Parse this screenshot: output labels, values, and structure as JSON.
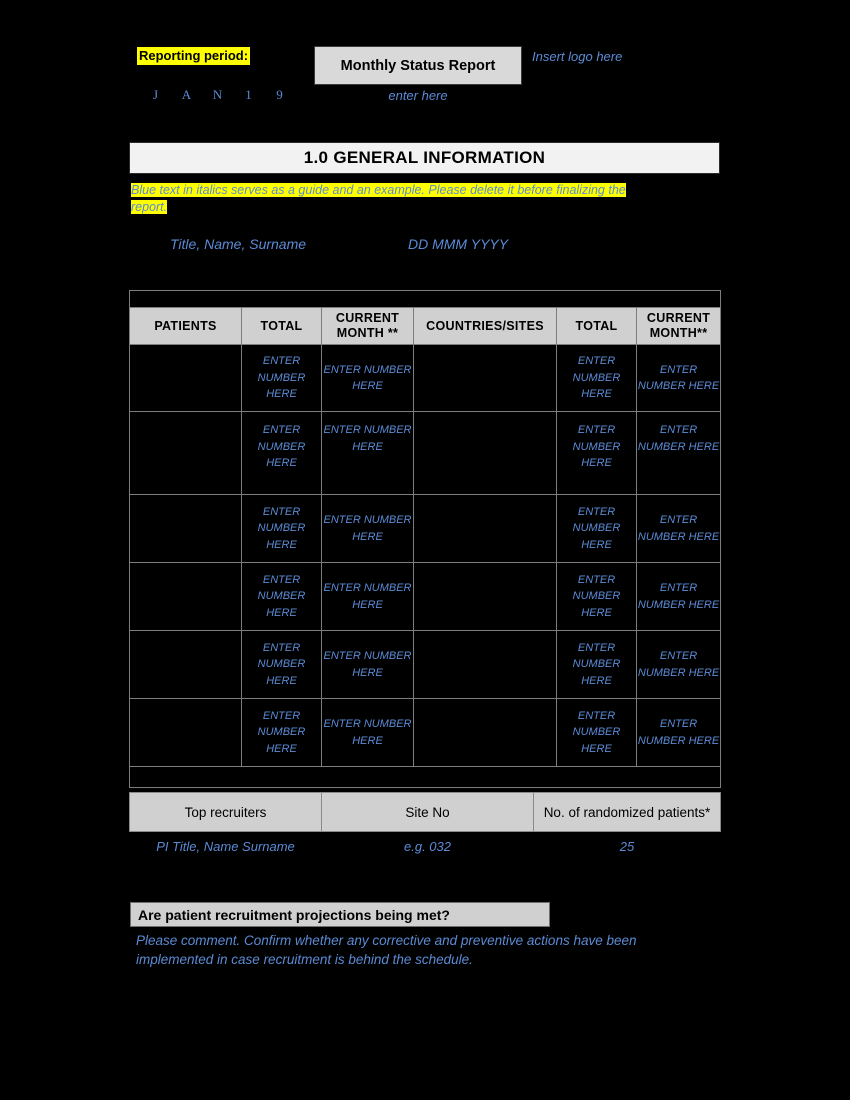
{
  "header": {
    "reporting_period_label": "Reporting period:",
    "period_chars": [
      "J",
      "A",
      "N",
      "1",
      "9"
    ],
    "document_title": "Monthly Status Report",
    "title_hint": "enter here",
    "logo_placeholder": "Insert logo here"
  },
  "section": {
    "banner_title": "1.0 GENERAL INFORMATION",
    "guide_note": "Blue text in italics serves as a guide and an example. Please delete it before finalizing the report.",
    "author_placeholder": "Title, Name, Surname",
    "date_placeholder": "DD MMM YYYY"
  },
  "main_table": {
    "headers": [
      "PATIENTS",
      "TOTAL",
      "CURRENT MONTH **",
      "COUNTRIES/SITES",
      "TOTAL",
      "CURRENT MONTH**"
    ],
    "number_placeholder": "ENTER NUMBER HERE",
    "rows": [
      {
        "patients": "",
        "total": "ENTER NUMBER HERE",
        "current_month": "ENTER NUMBER HERE",
        "countries_sites": "",
        "total2": "ENTER NUMBER HERE",
        "current_month2": "ENTER NUMBER HERE"
      },
      {
        "patients": "",
        "total": "ENTER NUMBER HERE",
        "current_month": "ENTER NUMBER HERE",
        "countries_sites": "",
        "total2": "ENTER NUMBER HERE",
        "current_month2": "ENTER NUMBER HERE"
      },
      {
        "patients": "",
        "total": "ENTER NUMBER HERE",
        "current_month": "ENTER NUMBER HERE",
        "countries_sites": "",
        "total2": "ENTER NUMBER HERE",
        "current_month2": "ENTER NUMBER HERE"
      },
      {
        "patients": "",
        "total": "ENTER NUMBER HERE",
        "current_month": "ENTER NUMBER HERE",
        "countries_sites": "",
        "total2": "ENTER NUMBER HERE",
        "current_month2": "ENTER NUMBER HERE"
      },
      {
        "patients": "",
        "total": "ENTER NUMBER HERE",
        "current_month": "ENTER NUMBER HERE",
        "countries_sites": "",
        "total2": "ENTER NUMBER HERE",
        "current_month2": "ENTER NUMBER HERE"
      },
      {
        "patients": "",
        "total": "ENTER NUMBER HERE",
        "current_month": "ENTER NUMBER HERE",
        "countries_sites": "",
        "total2": "ENTER NUMBER HERE",
        "current_month2": "ENTER NUMBER HERE"
      }
    ]
  },
  "recruiters_table": {
    "headers": [
      "Top recruiters",
      "Site No",
      "No. of randomized patients*"
    ],
    "row": [
      "PI Title, Name Surname",
      "e.g. 032",
      "25"
    ]
  },
  "question": {
    "label": "Are patient recruitment projections being met?",
    "answer": "Please comment. Confirm whether any corrective and preventive actions have been implemented in case recruitment is behind the schedule."
  },
  "colors": {
    "highlight": "#ffff00",
    "guide_blue": "#5b8bd5",
    "header_grey": "#d0d0d0",
    "banner_grey": "#f2f2f2",
    "page_background": "#000000"
  }
}
